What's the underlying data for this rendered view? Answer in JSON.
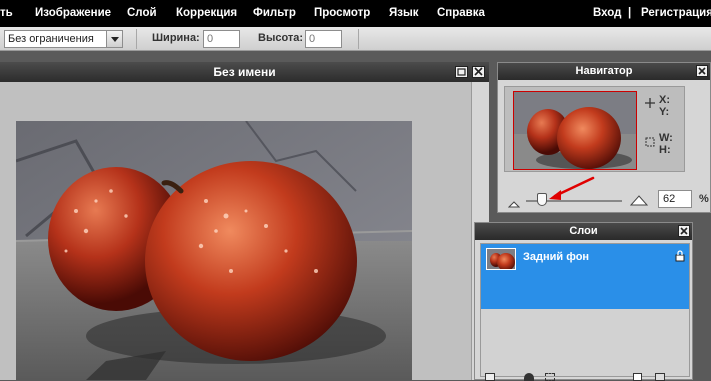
{
  "menu": {
    "items": [
      "ть",
      "Изображение",
      "Слой",
      "Коррекция",
      "Фильтр",
      "Просмотр",
      "Язык",
      "Справка"
    ],
    "login": "Вход",
    "separator": "|",
    "register": "Регистрация"
  },
  "options": {
    "constraint": "Без ограничения",
    "width_label": "Ширина:",
    "width_value": "0",
    "height_label": "Высота:",
    "height_value": "0"
  },
  "document": {
    "title": "Без имени"
  },
  "navigator": {
    "title": "Навигатор",
    "x_label": "X:",
    "y_label": "Y:",
    "w_label": "W:",
    "h_label": "H:",
    "zoom_value": "62",
    "zoom_unit": "%"
  },
  "layers": {
    "title": "Слои",
    "layer_name": "Задний фон"
  },
  "colors": {
    "menubar": "#000000",
    "panel_title": "#333333",
    "selection": "#2a8fe8",
    "annotation_arrow": "#e00000"
  }
}
